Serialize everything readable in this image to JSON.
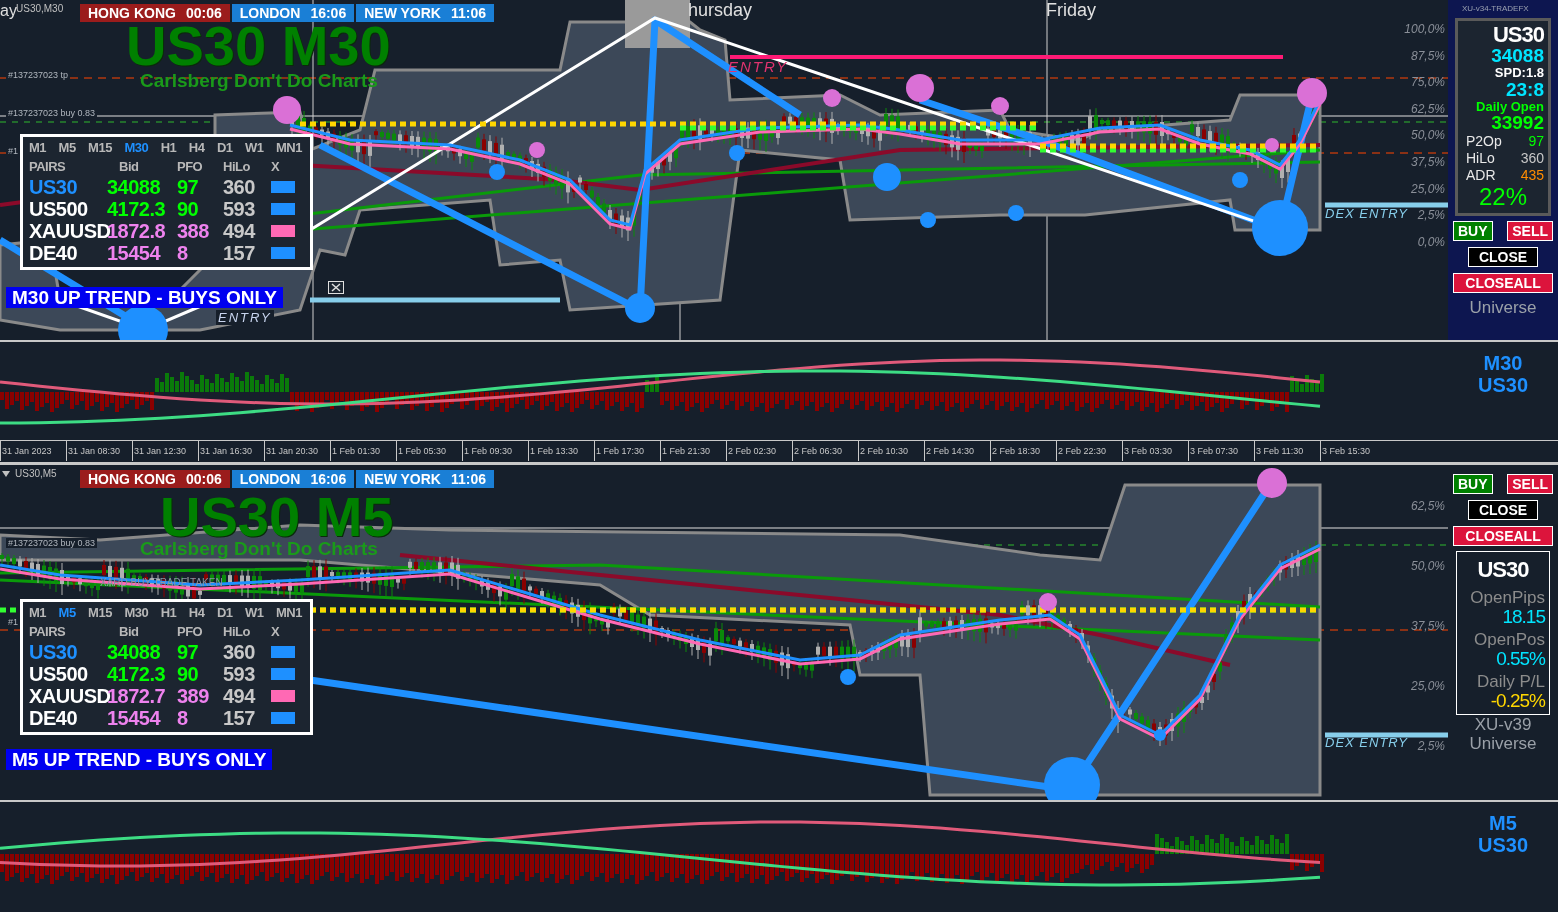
{
  "panes": [
    {
      "symbol_label": "US30,M30",
      "news_close_button": true,
      "day_labels": [
        "ay",
        "hursday",
        "Friday"
      ],
      "sessions": [
        {
          "city": "HONG KONG",
          "time": "00:06",
          "color": "#9b1c1c"
        },
        {
          "city": "LONDON",
          "time": "16:06",
          "color": "#1a7fd6"
        },
        {
          "city": "NEW YORK",
          "time": "11:06",
          "color": "#1a7fd6"
        }
      ],
      "title": "US30 M30",
      "subtitle": "Carlsberg Don't Do Charts",
      "order_labels": [
        "#137237023 tp",
        "#137237023 buy 0.83",
        "#1"
      ],
      "signal_labels": [
        {
          "text": "ENTRY",
          "kind": "entry"
        },
        {
          "text": "ENTRY",
          "kind": "faded"
        },
        {
          "text": "DEX ENTRY",
          "kind": "dex"
        }
      ],
      "timeframes": [
        {
          "label": "M1",
          "selected": false
        },
        {
          "label": "M5",
          "selected": false
        },
        {
          "label": "M15",
          "selected": false
        },
        {
          "label": "M30",
          "selected": true
        },
        {
          "label": "H1",
          "selected": false
        },
        {
          "label": "H4",
          "selected": false
        },
        {
          "label": "D1",
          "selected": false
        },
        {
          "label": "W1",
          "selected": false
        },
        {
          "label": "MN1",
          "selected": false
        }
      ],
      "pairs_table": {
        "columns": [
          "PAIRS",
          "Bid",
          "PFO",
          "HiLo",
          "X"
        ],
        "rows": [
          {
            "pair": "US30",
            "bid": {
              "text": "34088",
              "color": "#00ff00"
            },
            "pfo": {
              "text": "97",
              "color": "#00ff00"
            },
            "hilo": "360",
            "selected": true,
            "color": "#1e90ff"
          },
          {
            "pair": "US500",
            "bid": {
              "text": "4172.3",
              "color": "#00ff00"
            },
            "pfo": {
              "text": "90",
              "color": "#00ff00"
            },
            "hilo": "593",
            "selected": false,
            "color": "#1e90ff"
          },
          {
            "pair": "XAUUSD",
            "bid": {
              "text": "1872.8",
              "color": "#ee82ee"
            },
            "pfo": {
              "text": "388",
              "color": "#ee82ee"
            },
            "hilo": "494",
            "selected": false,
            "color": "#ff69b4"
          },
          {
            "pair": "DE40",
            "bid": {
              "text": "15454",
              "color": "#ee82ee"
            },
            "pfo": {
              "text": "8",
              "color": "#ee82ee"
            },
            "hilo": "157",
            "selected": false,
            "color": "#1e90ff"
          }
        ]
      },
      "trend_banner": "M30 UP TREND - BUYS ONLY",
      "percent_levels": [
        "100,0%",
        "87,5%",
        "75,0%",
        "62,5%",
        "50,0%",
        "37,5%",
        "25,0%",
        "2,5%",
        "0,0%"
      ],
      "side_panel": {
        "kind": "dashboard",
        "watermark": "XU-v34-TRADEFX",
        "blocks": [
          {
            "kind": "info_box",
            "lines": [
              {
                "kind": "title",
                "text": "US30",
                "color": "#ffffff"
              },
              {
                "kind": "figure",
                "text": "34088",
                "color": "#00e5ff"
              },
              {
                "kind": "note",
                "text": "SPD:1.8",
                "color": "#ffffff"
              },
              {
                "kind": "figure",
                "text": "23:8",
                "color": "#00e5ff"
              },
              {
                "kind": "note",
                "text": "Daily Open",
                "color": "#00ff00"
              },
              {
                "kind": "figure",
                "text": "33992",
                "color": "#00ff00"
              },
              {
                "kind": "pair",
                "label": "P2Op",
                "text": "97",
                "color": "#00ff00"
              },
              {
                "kind": "pair",
                "label": "HiLo",
                "text": "360",
                "color": "#c8c8c8"
              },
              {
                "kind": "pair",
                "label": "ADR",
                "text": "435",
                "color": "#ff8c00"
              },
              {
                "kind": "percent",
                "text": "22%",
                "color": "#00ff00"
              }
            ]
          },
          {
            "kind": "buttons",
            "buttons": [
              {
                "label": "BUY",
                "kind": "buy"
              },
              {
                "label": "SELL",
                "kind": "sell"
              },
              {
                "label": "CLOSE",
                "kind": "close"
              },
              {
                "label": "CLOSEALL",
                "kind": "closeall"
              }
            ]
          },
          {
            "kind": "caption",
            "lines": [
              "Universe"
            ]
          }
        ]
      },
      "indicator_labels": [
        "M30",
        "US30"
      ],
      "time_axis": [
        "31 Jan 2023",
        "31 Jan 08:30",
        "31 Jan 12:30",
        "31 Jan 16:30",
        "31 Jan 20:30",
        "1 Feb 01:30",
        "1 Feb 05:30",
        "1 Feb 09:30",
        "1 Feb 13:30",
        "1 Feb 17:30",
        "1 Feb 21:30",
        "2 Feb 02:30",
        "2 Feb 06:30",
        "2 Feb 10:30",
        "2 Feb 14:30",
        "2 Feb 18:30",
        "2 Feb 22:30",
        "3 Feb 03:30",
        "3 Feb 07:30",
        "3 Feb 11:30",
        "3 Feb 15:30"
      ]
    },
    {
      "symbol_label": "US30,M5",
      "menu_caret": true,
      "sessions": [
        {
          "city": "HONG KONG",
          "time": "00:06",
          "color": "#9b1c1c"
        },
        {
          "city": "LONDON",
          "time": "16:06",
          "color": "#1a7fd6"
        },
        {
          "city": "NEW YORK",
          "time": "11:06",
          "color": "#1a7fd6"
        }
      ],
      "title": "US30 M5",
      "subtitle": "Carlsberg Don't Do Charts",
      "order_labels": [
        "#137237023 buy 0.83",
        "#1"
      ],
      "signal_labels": [
        {
          "text": "XARD BUY TRADE TAKEN",
          "kind": "note"
        },
        {
          "text": "DEX ENTRY",
          "kind": "dex"
        }
      ],
      "timeframes": [
        {
          "label": "M1",
          "selected": false
        },
        {
          "label": "M5",
          "selected": true
        },
        {
          "label": "M15",
          "selected": false
        },
        {
          "label": "M30",
          "selected": false
        },
        {
          "label": "H1",
          "selected": false
        },
        {
          "label": "H4",
          "selected": false
        },
        {
          "label": "D1",
          "selected": false
        },
        {
          "label": "W1",
          "selected": false
        },
        {
          "label": "MN1",
          "selected": false
        }
      ],
      "pairs_table": {
        "columns": [
          "PAIRS",
          "Bid",
          "PFO",
          "HiLo",
          "X"
        ],
        "rows": [
          {
            "pair": "US30",
            "bid": {
              "text": "34088",
              "color": "#00ff00"
            },
            "pfo": {
              "text": "97",
              "color": "#00ff00"
            },
            "hilo": "360",
            "selected": true,
            "color": "#1e90ff"
          },
          {
            "pair": "US500",
            "bid": {
              "text": "4172.3",
              "color": "#00ff00"
            },
            "pfo": {
              "text": "90",
              "color": "#00ff00"
            },
            "hilo": "593",
            "selected": false,
            "color": "#1e90ff"
          },
          {
            "pair": "XAUUSD",
            "bid": {
              "text": "1872.7",
              "color": "#ee82ee"
            },
            "pfo": {
              "text": "389",
              "color": "#ee82ee"
            },
            "hilo": "494",
            "selected": false,
            "color": "#ff69b4"
          },
          {
            "pair": "DE40",
            "bid": {
              "text": "15454",
              "color": "#ee82ee"
            },
            "pfo": {
              "text": "8",
              "color": "#ee82ee"
            },
            "hilo": "157",
            "selected": false,
            "color": "#1e90ff"
          }
        ]
      },
      "trend_banner": "M5 UP TREND - BUYS ONLY",
      "percent_levels": [
        "62,5%",
        "50,0%",
        "37,5%",
        "25,0%",
        "2,5%"
      ],
      "side_panel": {
        "kind": "positions",
        "blocks": [
          {
            "kind": "buttons",
            "buttons": [
              {
                "label": "BUY",
                "kind": "buy"
              },
              {
                "label": "SELL",
                "kind": "sell"
              },
              {
                "label": "CLOSE",
                "kind": "close"
              },
              {
                "label": "CLOSEALL",
                "kind": "closeall"
              }
            ]
          },
          {
            "kind": "info_box",
            "lines": [
              {
                "kind": "title",
                "text": "US30",
                "color": "#ffffff"
              },
              {
                "kind": "label",
                "text": "OpenPips",
                "color": "#8c8c8c"
              },
              {
                "kind": "digital",
                "text": "18.15",
                "color": "#00e5ff"
              },
              {
                "kind": "label",
                "text": "OpenPos",
                "color": "#8c8c8c"
              },
              {
                "kind": "digital",
                "text": "0.55%",
                "color": "#00e5ff"
              },
              {
                "kind": "label",
                "text": "Daily P/L",
                "color": "#8c8c8c"
              },
              {
                "kind": "digital",
                "text": "-0.25%",
                "color": "#ffd700"
              }
            ]
          },
          {
            "kind": "caption",
            "lines": [
              "XU-v39",
              "Universe"
            ]
          }
        ]
      },
      "indicator_labels": [
        "M5",
        "US30"
      ]
    }
  ]
}
